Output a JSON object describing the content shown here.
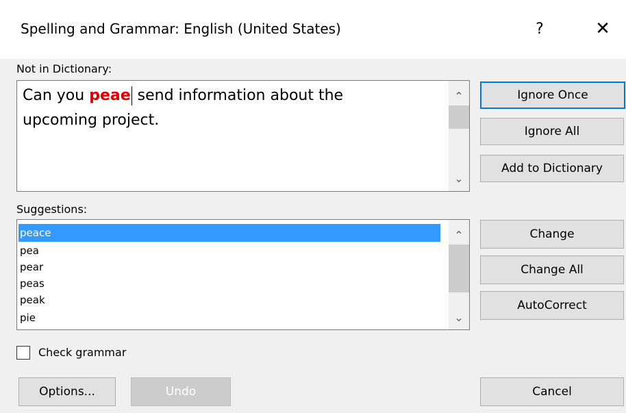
{
  "window": {
    "title": "Spelling and Grammar: English (United States)",
    "help": "?",
    "close": "✕"
  },
  "not_in_dictionary": {
    "label": "Not in Dictionary:",
    "text_before": "Can you ",
    "error_word": "peae",
    "text_after": " send information about the",
    "line2": "upcoming project."
  },
  "suggestions": {
    "label": "Suggestions:",
    "items": [
      "peace",
      "pea",
      "pear",
      "peas",
      "peak",
      "pie"
    ],
    "selected_index": 0
  },
  "buttons": {
    "ignore_once": "Ignore Once",
    "ignore_all": "Ignore All",
    "add_to_dictionary": "Add to Dictionary",
    "change": "Change",
    "change_all": "Change All",
    "autocorrect": "AutoCorrect",
    "options": "Options...",
    "undo": "Undo",
    "cancel": "Cancel"
  },
  "check_grammar": {
    "label": "Check grammar",
    "checked": false
  },
  "scroll": {
    "up": "⌃",
    "down": "⌄"
  }
}
